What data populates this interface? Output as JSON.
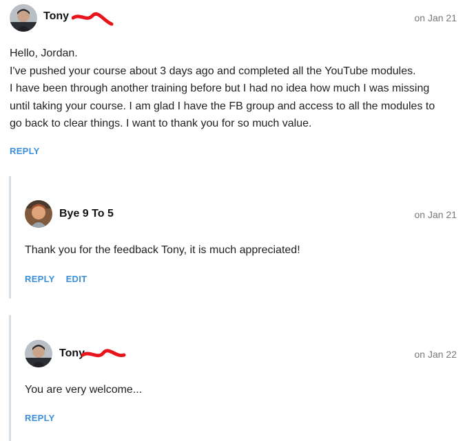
{
  "comments": [
    {
      "author": "Tony",
      "date": "on Jan 21",
      "lines": [
        "Hello, Jordan.",
        "I've pushed your course about 3 days ago and completed all the YouTube modules.",
        "I have been through another training before but I had no idea how much I was missing",
        "until taking your course. I am glad I have the FB group and access to all the modules to",
        "go back to clear things. I want to thank you for so much value."
      ],
      "reply_label": "REPLY"
    },
    {
      "author": "Bye 9 To 5",
      "date": "on Jan 21",
      "text": "Thank you for the feedback Tony, it is much appreciated!",
      "reply_label": "REPLY",
      "edit_label": "EDIT"
    },
    {
      "author": "Tony",
      "date": "on Jan 22",
      "text": "You are very welcome...",
      "reply_label": "REPLY"
    }
  ],
  "colors": {
    "accent": "#3a8fd8",
    "redaction": "#e8141c",
    "thread_bar": "#d6dde3"
  },
  "icons": {
    "avatar_tony": "user-avatar-photo",
    "avatar_bye9to5": "user-avatar-photo",
    "redaction": "red-scribble-redaction"
  }
}
